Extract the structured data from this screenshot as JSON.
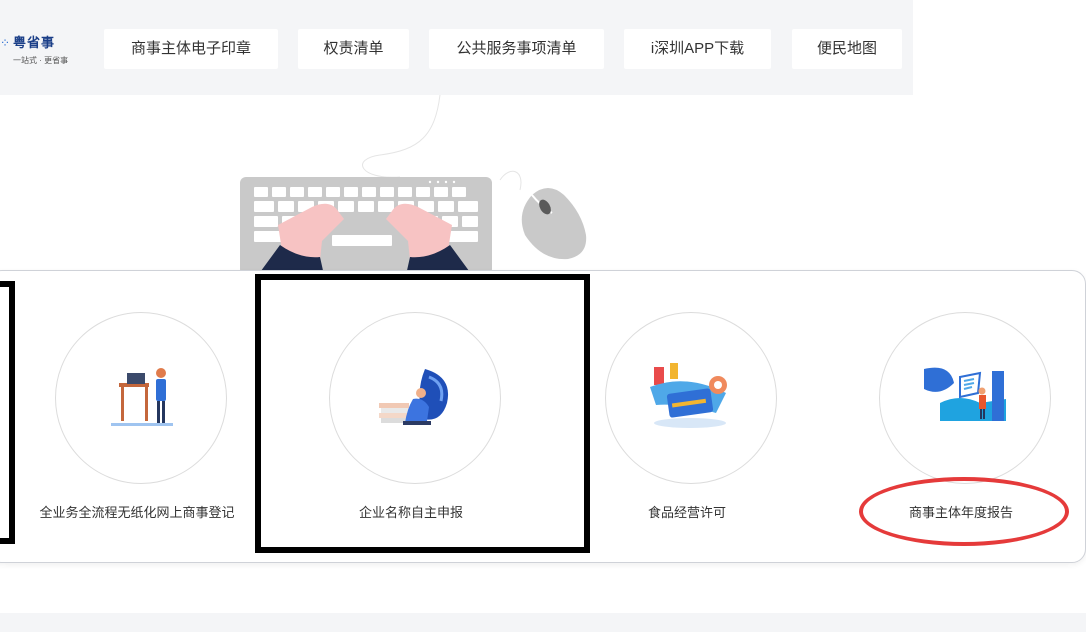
{
  "header": {
    "logo": {
      "name": "粤省事",
      "slogan": "一站式 · 更省事"
    },
    "nav": [
      {
        "label": "商事主体电子印章"
      },
      {
        "label": "权责清单"
      },
      {
        "label": "公共服务事项清单"
      },
      {
        "label": "i深圳APP下载"
      },
      {
        "label": "便民地图"
      }
    ]
  },
  "services": [
    {
      "label": "全业务全流程无纸化网上商事登记",
      "icon": "person-at-desk-illustration"
    },
    {
      "label": "企业名称自主申报",
      "icon": "person-with-books-illustration"
    },
    {
      "label": "食品经营许可",
      "icon": "food-card-illustration"
    },
    {
      "label": "商事主体年度报告",
      "icon": "report-chart-illustration"
    }
  ],
  "colors": {
    "background": "#ffffff",
    "topbar": "#f4f5f7",
    "accent_blue": "#2d6fd3",
    "highlight_red": "#e53a3a",
    "highlight_black": "#000000"
  }
}
